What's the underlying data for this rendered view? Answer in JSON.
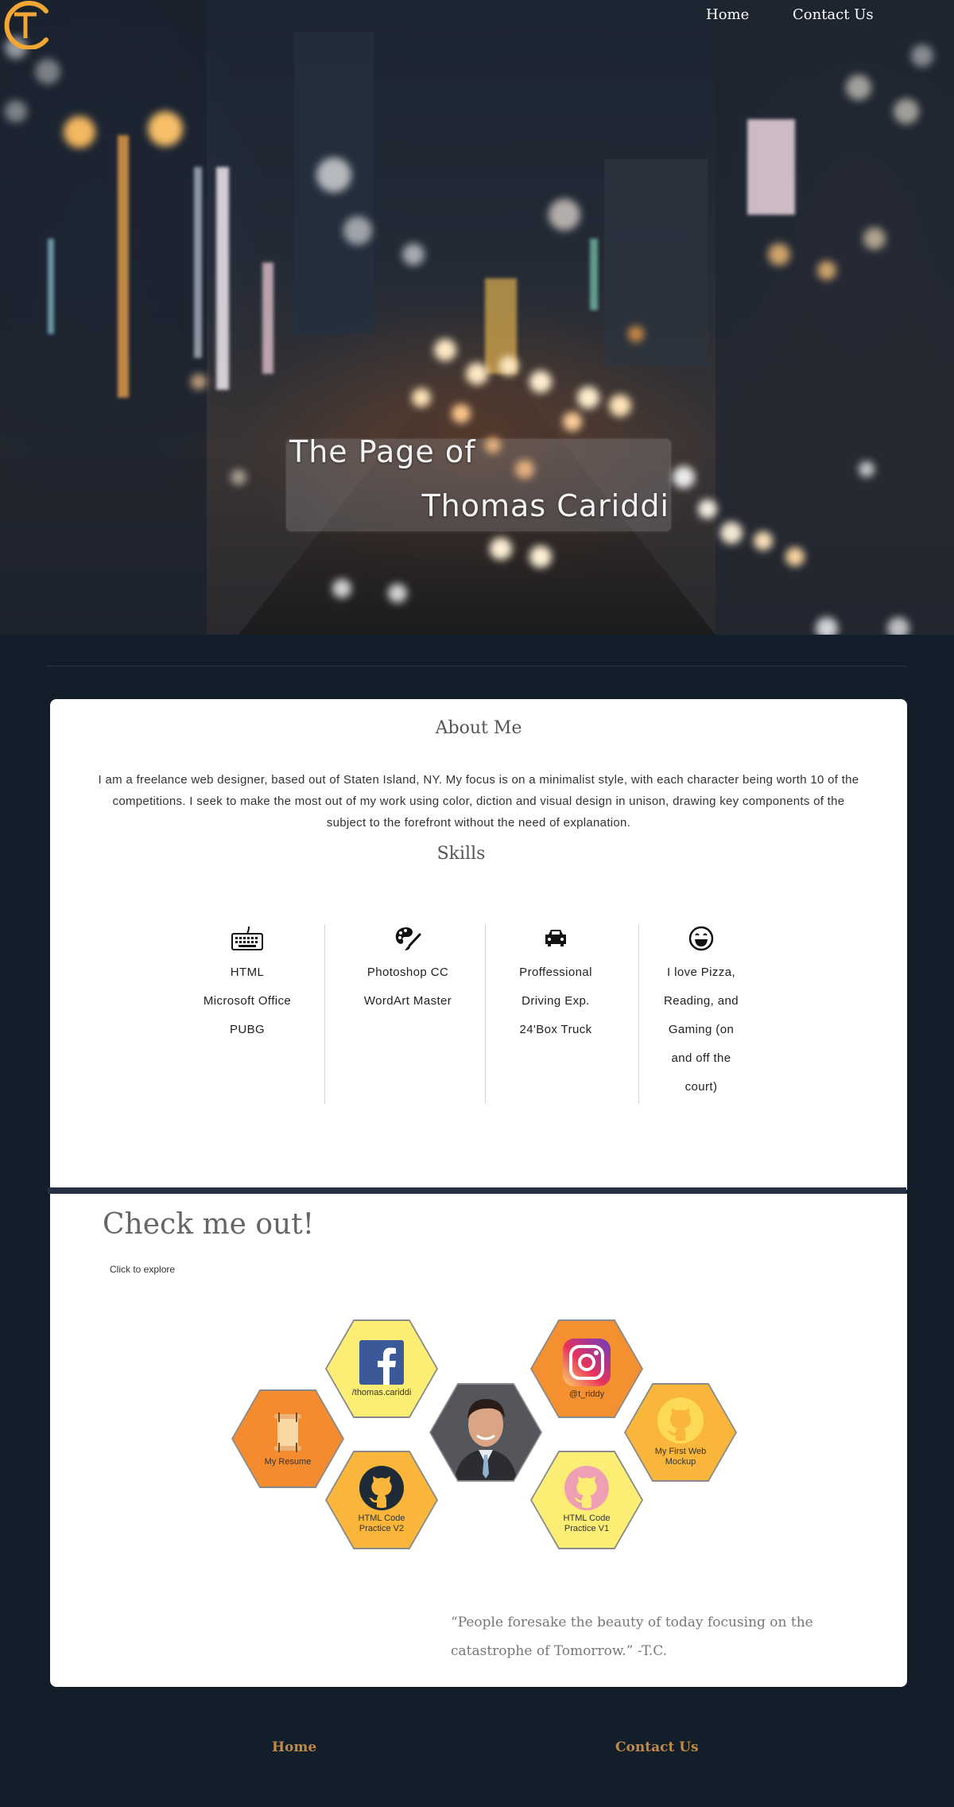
{
  "header": {
    "logo_letters": "TC",
    "nav": [
      {
        "label": "Home"
      },
      {
        "label": "Contact Us"
      }
    ]
  },
  "hero": {
    "title_line1": "The Page of",
    "title_line2": "Thomas Cariddi"
  },
  "about": {
    "heading": "About Me",
    "text": "I am a freelance web designer, based out of Staten Island, NY. My focus is on a minimalist style, with each character being worth 10 of the competitions. I seek to make the most out of my work using color, diction and visual design in unison, drawing key components of the subject to the forefront without the need of explanation."
  },
  "skills": {
    "heading": "Skills",
    "columns": [
      {
        "icon": "keyboard-icon",
        "lines": [
          "HTML",
          "Microsoft Office",
          "PUBG"
        ]
      },
      {
        "icon": "palette-icon",
        "lines": [
          "Photoshop CC",
          "WordArt Master"
        ]
      },
      {
        "icon": "car-icon",
        "lines": [
          "Proffessional",
          "Driving Exp.",
          "24'Box Truck"
        ]
      },
      {
        "icon": "laughing-face-icon",
        "lines": [
          "I love Pizza,",
          "Reading, and",
          "Gaming (on",
          "and off the",
          "court)"
        ]
      }
    ]
  },
  "check": {
    "title": "Check me out!",
    "subtitle": "Click to explore",
    "tiles": [
      {
        "icon": "resume-scroll-icon",
        "caption": "My Resume",
        "color": "#f48b2f"
      },
      {
        "icon": "facebook-icon",
        "caption": "/thomas.cariddi",
        "color": "#fcee74"
      },
      {
        "icon": "github-icon",
        "caption": "HTML Code Practice V2",
        "color": "#f9b63a"
      },
      {
        "icon": "profile-photo",
        "caption": "",
        "color": "#555555"
      },
      {
        "icon": "instagram-icon",
        "caption": "@t_riddy",
        "color": "#f4902f"
      },
      {
        "icon": "github-icon",
        "caption": "HTML Code Practice V1",
        "color": "#fcee74"
      },
      {
        "icon": "github-icon",
        "caption": "My First Web Mockup",
        "color": "#f9b63a"
      }
    ],
    "quote": "“People foresake the beauty of today focusing on the catastrophe of Tomorrow.” -T.C."
  },
  "footer": {
    "nav": [
      {
        "label": "Home"
      },
      {
        "label": "Contact Us"
      }
    ]
  },
  "colors": {
    "page_bg": "#131e2b",
    "accent": "#f2a735",
    "footer_link": "#c28a44",
    "band": "#233140"
  }
}
